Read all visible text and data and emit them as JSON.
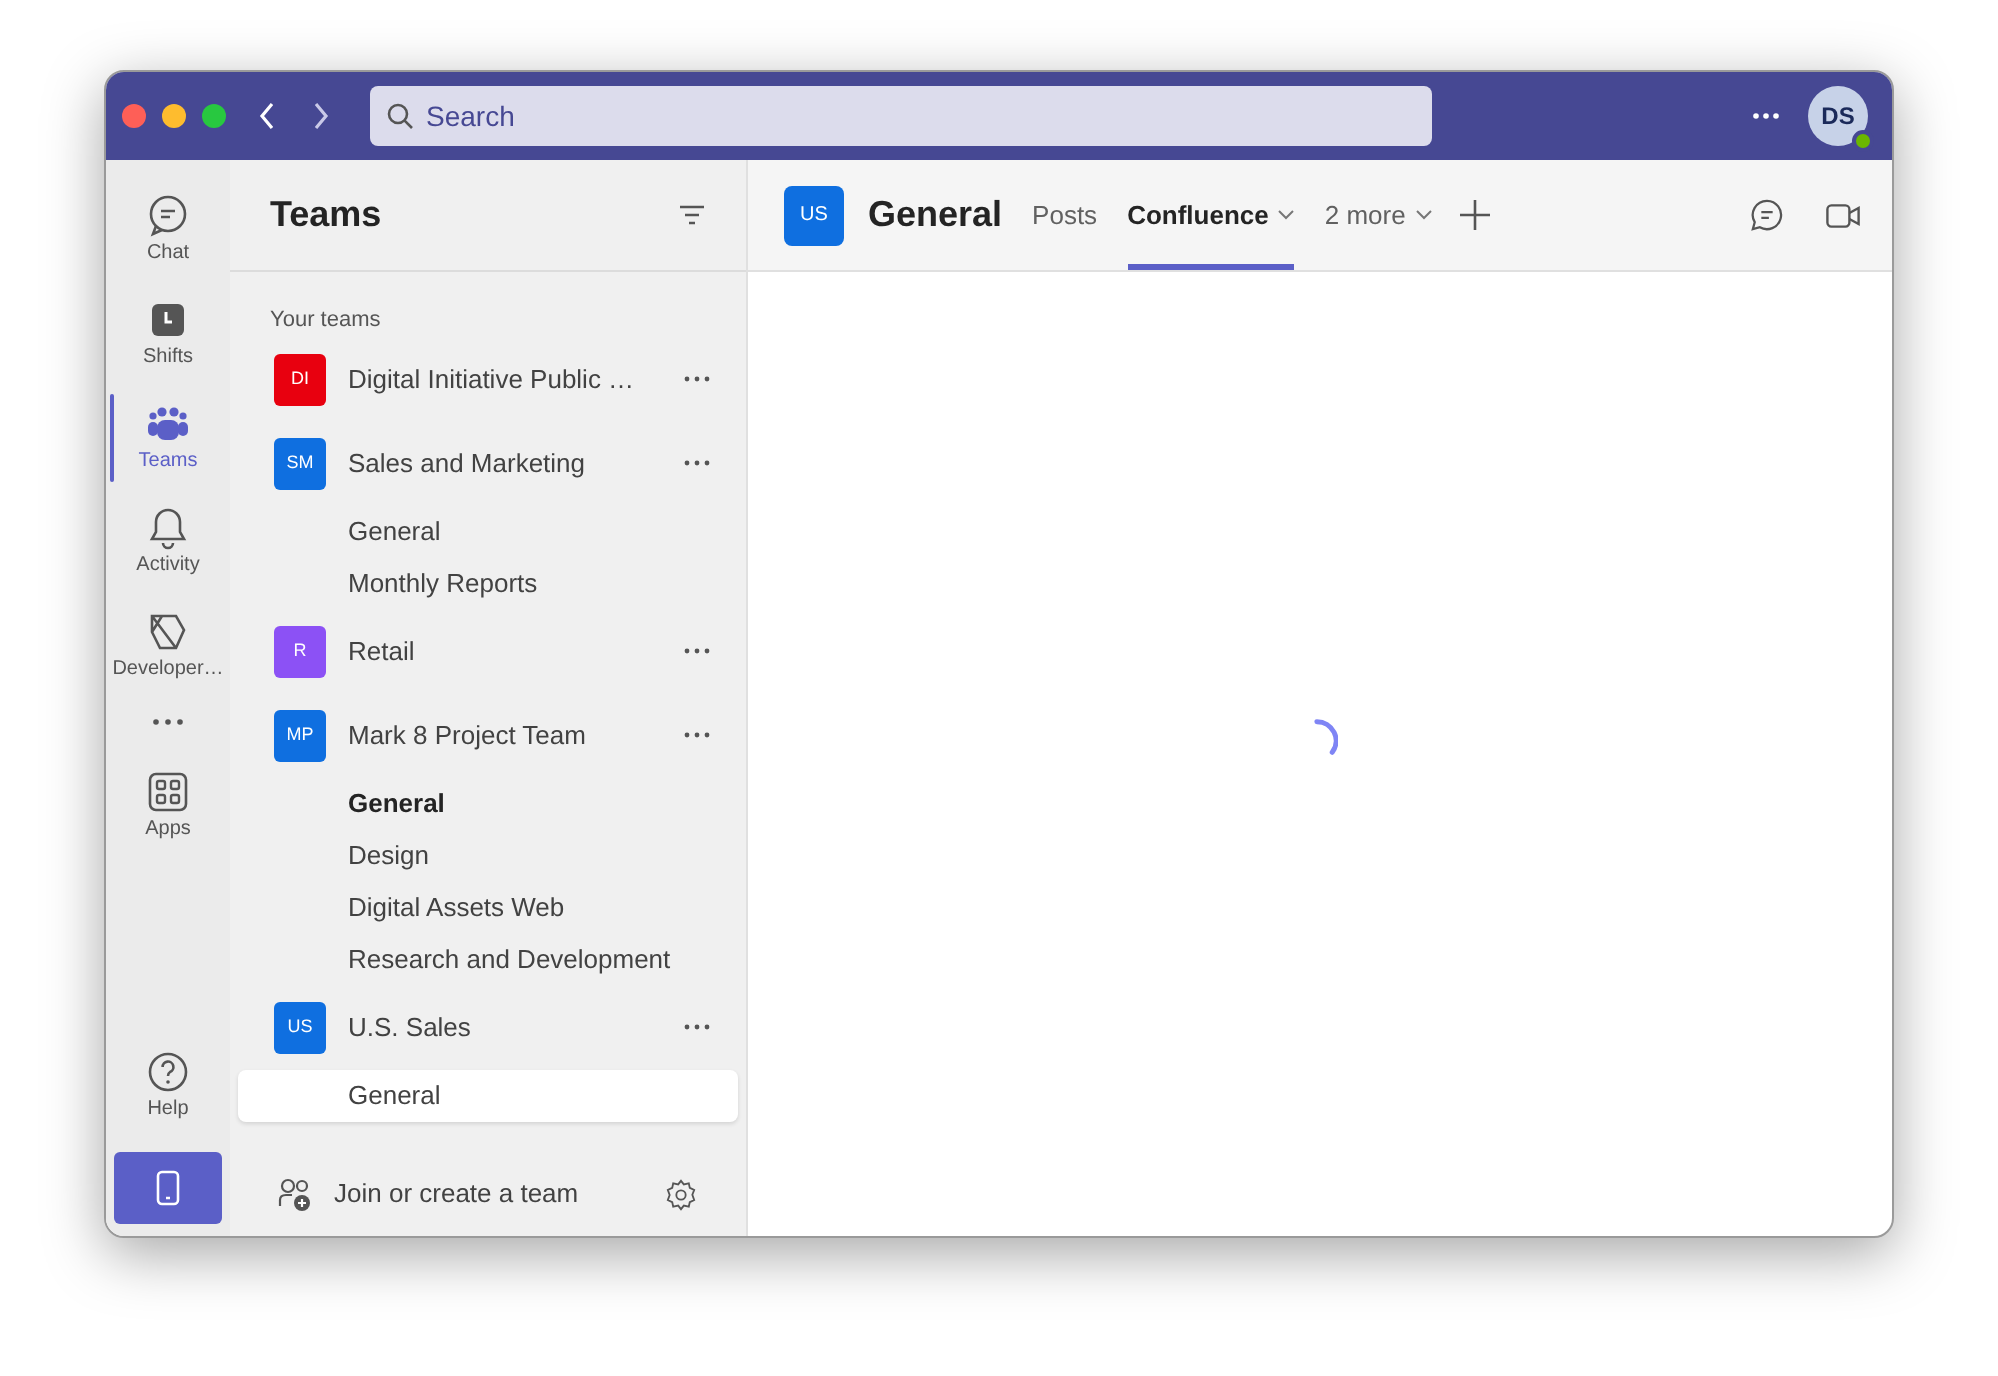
{
  "title_bar": {
    "search": {
      "placeholder": "Search"
    },
    "user": {
      "initials": "DS"
    }
  },
  "rail": {
    "items": [
      {
        "label": "Chat",
        "selected": false
      },
      {
        "label": "Shifts",
        "selected": false
      },
      {
        "label": "Teams",
        "selected": true
      },
      {
        "label": "Activity",
        "selected": false
      },
      {
        "label": "Developer…",
        "selected": false
      }
    ],
    "bottom_items": [
      {
        "label": "Apps",
        "selected": false
      },
      {
        "label": "Help",
        "selected": false
      }
    ]
  },
  "teams_panel": {
    "title": "Teams",
    "section": "Your teams",
    "teams": [
      {
        "initials": "DI",
        "name": "Digital Initiative Public …",
        "color": "#e8000f"
      },
      {
        "initials": "SM",
        "name": "Sales and Marketing",
        "color": "#0f6fe0",
        "channels": [
          {
            "name": "General",
            "unread": false,
            "selected": false
          },
          {
            "name": "Monthly Reports",
            "unread": false,
            "selected": false
          }
        ]
      },
      {
        "initials": "R",
        "name": "Retail",
        "color": "#8c51f5"
      },
      {
        "initials": "MP",
        "name": "Mark 8 Project Team",
        "color": "#0f6fe0",
        "channels": [
          {
            "name": "General",
            "unread": true,
            "selected": false
          },
          {
            "name": "Design",
            "unread": false,
            "selected": false
          },
          {
            "name": "Digital Assets Web",
            "unread": false,
            "selected": false
          },
          {
            "name": "Research and Development",
            "unread": false,
            "selected": false
          }
        ]
      },
      {
        "initials": "US",
        "name": "U.S. Sales",
        "color": "#0f6fe0",
        "channels": [
          {
            "name": "General",
            "unread": false,
            "selected": true
          }
        ]
      }
    ],
    "footer": "Join or create a team"
  },
  "channel_header": {
    "initials": "US",
    "color": "#0f6fe0",
    "title": "General",
    "tabs": [
      {
        "label": "Posts",
        "selected": false,
        "dropdown": false
      },
      {
        "label": "Confluence",
        "selected": true,
        "dropdown": true
      },
      {
        "label": "2 more",
        "selected": false,
        "dropdown": true
      }
    ]
  }
}
